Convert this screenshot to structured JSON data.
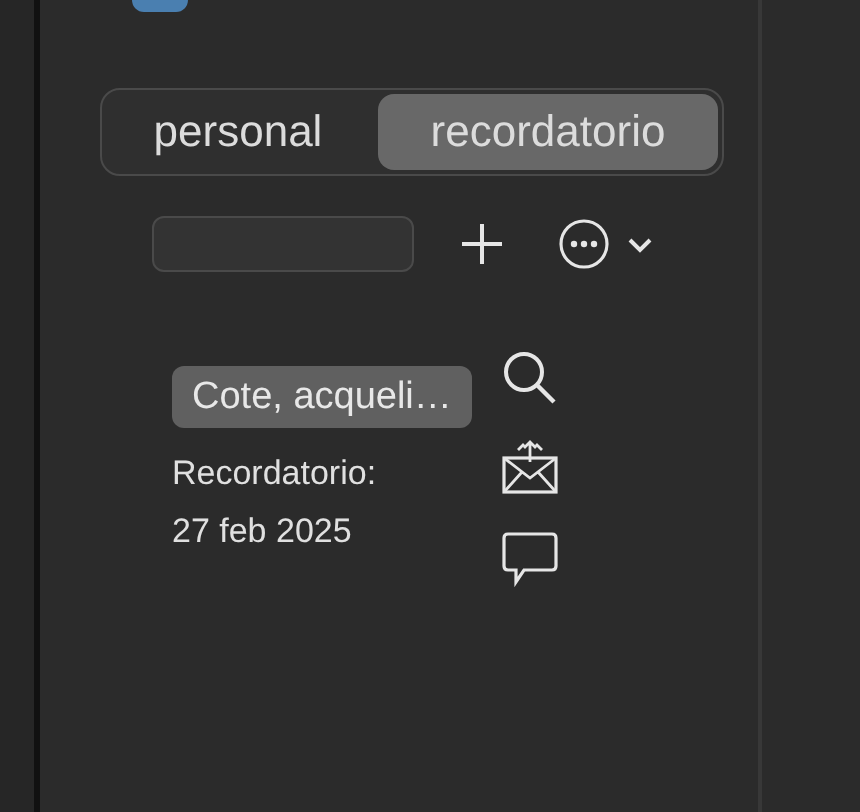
{
  "tabs": [
    {
      "label": "personal",
      "selected": false
    },
    {
      "label": "recordatorio",
      "selected": true
    }
  ],
  "note": {
    "tag": "Cote, acqueli…",
    "label": "Recordatorio:",
    "date": "27 feb 2025"
  }
}
